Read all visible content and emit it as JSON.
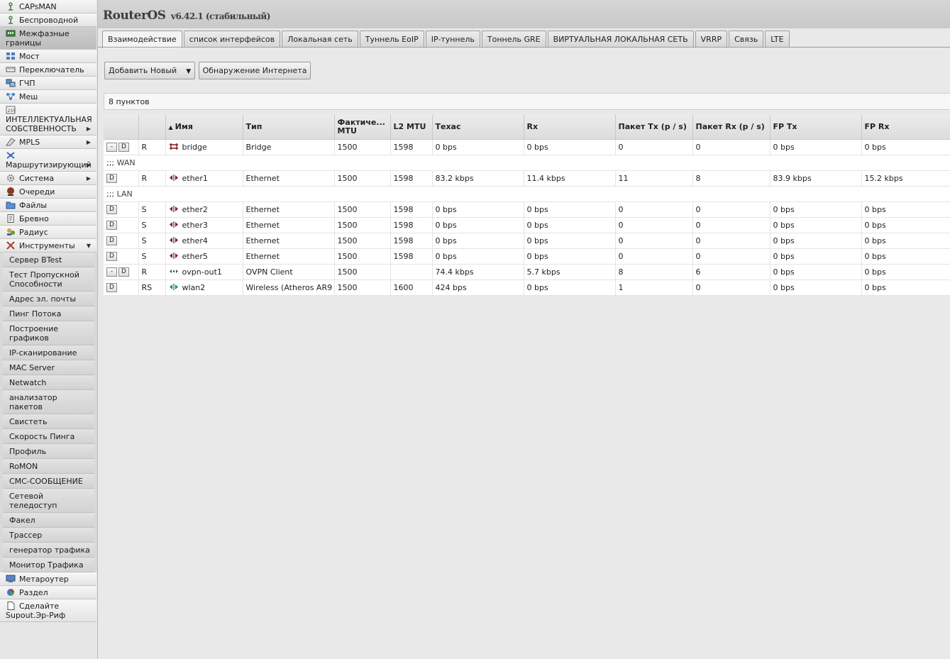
{
  "sidebar": {
    "items": [
      {
        "label": "CAPsMAN",
        "icon": "antenna-icon"
      },
      {
        "label": "Беспроводной",
        "icon": "antenna-icon"
      },
      {
        "label": "Межфазные границы",
        "icon": "ethernet-card-icon",
        "active": true
      },
      {
        "label": "Мост",
        "icon": "bridge-icon"
      },
      {
        "label": "Переключатель",
        "icon": "switch-icon"
      },
      {
        "label": "ГЧП",
        "icon": "ppp-icon"
      },
      {
        "label": "Меш",
        "icon": "mesh-icon"
      },
      {
        "label": "ИНТЕЛЛЕКТУАЛЬНАЯ СОБСТВЕННОСТЬ",
        "icon": "ip-icon",
        "arrow": "▶"
      },
      {
        "label": "MPLS",
        "icon": "mpls-icon",
        "arrow": "▶"
      },
      {
        "label": "Маршрутизирующий",
        "icon": "routing-icon",
        "arrow": "▶"
      },
      {
        "label": "Система",
        "icon": "gear-icon",
        "arrow": "▶"
      },
      {
        "label": "Очереди",
        "icon": "queue-icon"
      },
      {
        "label": "Файлы",
        "icon": "folder-icon"
      },
      {
        "label": "Бревно",
        "icon": "log-icon"
      },
      {
        "label": "Радиус",
        "icon": "radius-icon"
      },
      {
        "label": "Инструменты",
        "icon": "tools-icon",
        "arrow": "▼"
      }
    ],
    "tools_submenu": [
      "Сервер BTest",
      "Тест Пропускной Способности",
      "Адрес эл. почты",
      "Пинг Потока",
      "Построение графиков",
      "IP-сканирование",
      "MAC Server",
      "Netwatch",
      "анализатор пакетов",
      "Свистеть",
      "Скорость Пинга",
      "Профиль",
      "RoMON",
      "СМС-СООБЩЕНИЕ",
      "Сетевой теледоступ",
      "Факел",
      "Трассер",
      "генератор трафика",
      "Монитор Трафика"
    ],
    "bottom_items": [
      {
        "label": "Метароутер",
        "icon": "metarouter-icon"
      },
      {
        "label": "Раздел",
        "icon": "partition-icon"
      },
      {
        "label": "Сделайте Supout.Эр-Риф",
        "icon": "document-icon"
      }
    ]
  },
  "header": {
    "product": "RouterOS",
    "version": "v6.42.1 (стабильный)"
  },
  "tabs": [
    {
      "label": "Взаимодействие",
      "active": true
    },
    {
      "label": "список интерфейсов"
    },
    {
      "label": "Локальная сеть"
    },
    {
      "label": "Туннель EoIP"
    },
    {
      "label": "IP-туннель"
    },
    {
      "label": "Тоннель GRE"
    },
    {
      "label": "ВИРТУАЛЬНАЯ ЛОКАЛЬНАЯ СЕТЬ"
    },
    {
      "label": "VRRP"
    },
    {
      "label": "Связь"
    },
    {
      "label": "LTE"
    }
  ],
  "toolbar": {
    "add_new_label": "Добавить Новый",
    "add_new_caret": "▼",
    "detect_internet_label": "Обнаружение Интернета"
  },
  "item_count": "8 пунктов",
  "table": {
    "sort_indicator": "▲",
    "columns": [
      "",
      "",
      "Имя",
      "Тип",
      "Фактиче... MTU",
      "L2 MTU",
      "Техас",
      "Rx",
      "Пакет Tx (p / s)",
      "Пакет Rx (p / s)",
      "FP Tx",
      "FP Rx"
    ],
    "rows": [
      {
        "kind": "data",
        "buttons": [
          "-",
          "D"
        ],
        "flags": "R",
        "icon": "bridge",
        "name": "bridge",
        "type": "Bridge",
        "mtu": "1500",
        "l2mtu": "1598",
        "tx": "0 bps",
        "rx": "0 bps",
        "ptx": "0",
        "prx": "0",
        "fptx": "0 bps",
        "fprx": "0 bps"
      },
      {
        "kind": "comment",
        "text": ";;; WAN"
      },
      {
        "kind": "data",
        "buttons": [
          "D"
        ],
        "flags": "R",
        "icon": "ether",
        "name": "ether1",
        "type": "Ethernet",
        "mtu": "1500",
        "l2mtu": "1598",
        "tx": "83.2 kbps",
        "rx": "11.4 kbps",
        "ptx": "11",
        "prx": "8",
        "fptx": "83.9 kbps",
        "fprx": "15.2 kbps"
      },
      {
        "kind": "comment",
        "text": ";;; LAN"
      },
      {
        "kind": "data",
        "buttons": [
          "D"
        ],
        "flags": "S",
        "icon": "ether",
        "name": "ether2",
        "type": "Ethernet",
        "mtu": "1500",
        "l2mtu": "1598",
        "tx": "0 bps",
        "rx": "0 bps",
        "ptx": "0",
        "prx": "0",
        "fptx": "0 bps",
        "fprx": "0 bps"
      },
      {
        "kind": "data",
        "buttons": [
          "D"
        ],
        "flags": "S",
        "icon": "ether",
        "name": "ether3",
        "type": "Ethernet",
        "mtu": "1500",
        "l2mtu": "1598",
        "tx": "0 bps",
        "rx": "0 bps",
        "ptx": "0",
        "prx": "0",
        "fptx": "0 bps",
        "fprx": "0 bps"
      },
      {
        "kind": "data",
        "buttons": [
          "D"
        ],
        "flags": "S",
        "icon": "ether",
        "name": "ether4",
        "type": "Ethernet",
        "mtu": "1500",
        "l2mtu": "1598",
        "tx": "0 bps",
        "rx": "0 bps",
        "ptx": "0",
        "prx": "0",
        "fptx": "0 bps",
        "fprx": "0 bps"
      },
      {
        "kind": "data",
        "buttons": [
          "D"
        ],
        "flags": "S",
        "icon": "ether",
        "name": "ether5",
        "type": "Ethernet",
        "mtu": "1500",
        "l2mtu": "1598",
        "tx": "0 bps",
        "rx": "0 bps",
        "ptx": "0",
        "prx": "0",
        "fptx": "0 bps",
        "fprx": "0 bps"
      },
      {
        "kind": "data",
        "buttons": [
          "-",
          "D"
        ],
        "flags": "R",
        "icon": "ovpn",
        "name": "ovpn-out1",
        "type": "OVPN Client",
        "mtu": "1500",
        "l2mtu": "",
        "tx": "74.4 kbps",
        "rx": "5.7 kbps",
        "ptx": "8",
        "prx": "6",
        "fptx": "0 bps",
        "fprx": "0 bps"
      },
      {
        "kind": "data",
        "buttons": [
          "D"
        ],
        "flags": "RS",
        "icon": "wlan",
        "name": "wlan2",
        "type": "Wireless (Atheros AR9",
        "mtu": "1500",
        "l2mtu": "1600",
        "tx": "424 bps",
        "rx": "0 bps",
        "ptx": "1",
        "prx": "0",
        "fptx": "0 bps",
        "fprx": "0 bps"
      }
    ]
  },
  "colors": {
    "ether_icon": "#8b1a1a",
    "wlan_icon": "#1b8a7a",
    "bridge_icon": "#7a1a1a"
  }
}
